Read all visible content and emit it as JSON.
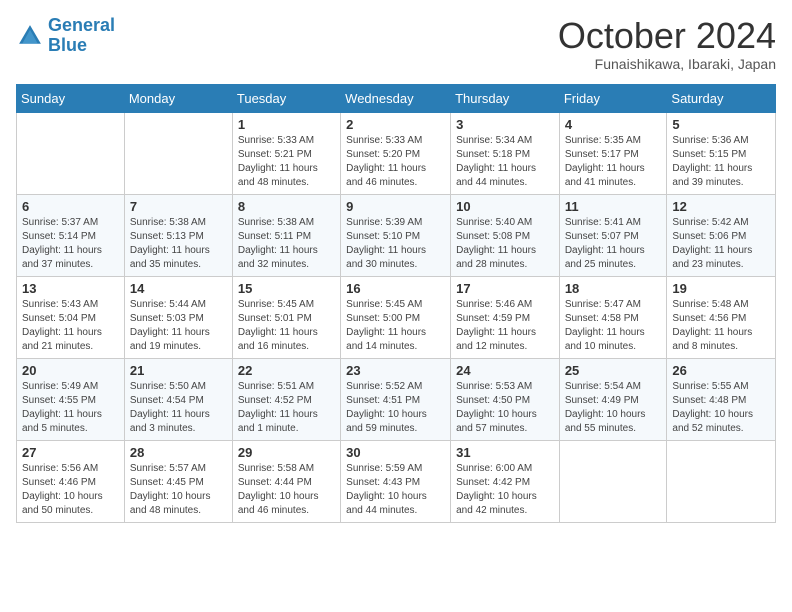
{
  "header": {
    "logo_line1": "General",
    "logo_line2": "Blue",
    "month": "October 2024",
    "location": "Funaishikawa, Ibaraki, Japan"
  },
  "weekdays": [
    "Sunday",
    "Monday",
    "Tuesday",
    "Wednesday",
    "Thursday",
    "Friday",
    "Saturday"
  ],
  "weeks": [
    [
      {
        "day": "",
        "detail": ""
      },
      {
        "day": "",
        "detail": ""
      },
      {
        "day": "1",
        "detail": "Sunrise: 5:33 AM\nSunset: 5:21 PM\nDaylight: 11 hours and 48 minutes."
      },
      {
        "day": "2",
        "detail": "Sunrise: 5:33 AM\nSunset: 5:20 PM\nDaylight: 11 hours and 46 minutes."
      },
      {
        "day": "3",
        "detail": "Sunrise: 5:34 AM\nSunset: 5:18 PM\nDaylight: 11 hours and 44 minutes."
      },
      {
        "day": "4",
        "detail": "Sunrise: 5:35 AM\nSunset: 5:17 PM\nDaylight: 11 hours and 41 minutes."
      },
      {
        "day": "5",
        "detail": "Sunrise: 5:36 AM\nSunset: 5:15 PM\nDaylight: 11 hours and 39 minutes."
      }
    ],
    [
      {
        "day": "6",
        "detail": "Sunrise: 5:37 AM\nSunset: 5:14 PM\nDaylight: 11 hours and 37 minutes."
      },
      {
        "day": "7",
        "detail": "Sunrise: 5:38 AM\nSunset: 5:13 PM\nDaylight: 11 hours and 35 minutes."
      },
      {
        "day": "8",
        "detail": "Sunrise: 5:38 AM\nSunset: 5:11 PM\nDaylight: 11 hours and 32 minutes."
      },
      {
        "day": "9",
        "detail": "Sunrise: 5:39 AM\nSunset: 5:10 PM\nDaylight: 11 hours and 30 minutes."
      },
      {
        "day": "10",
        "detail": "Sunrise: 5:40 AM\nSunset: 5:08 PM\nDaylight: 11 hours and 28 minutes."
      },
      {
        "day": "11",
        "detail": "Sunrise: 5:41 AM\nSunset: 5:07 PM\nDaylight: 11 hours and 25 minutes."
      },
      {
        "day": "12",
        "detail": "Sunrise: 5:42 AM\nSunset: 5:06 PM\nDaylight: 11 hours and 23 minutes."
      }
    ],
    [
      {
        "day": "13",
        "detail": "Sunrise: 5:43 AM\nSunset: 5:04 PM\nDaylight: 11 hours and 21 minutes."
      },
      {
        "day": "14",
        "detail": "Sunrise: 5:44 AM\nSunset: 5:03 PM\nDaylight: 11 hours and 19 minutes."
      },
      {
        "day": "15",
        "detail": "Sunrise: 5:45 AM\nSunset: 5:01 PM\nDaylight: 11 hours and 16 minutes."
      },
      {
        "day": "16",
        "detail": "Sunrise: 5:45 AM\nSunset: 5:00 PM\nDaylight: 11 hours and 14 minutes."
      },
      {
        "day": "17",
        "detail": "Sunrise: 5:46 AM\nSunset: 4:59 PM\nDaylight: 11 hours and 12 minutes."
      },
      {
        "day": "18",
        "detail": "Sunrise: 5:47 AM\nSunset: 4:58 PM\nDaylight: 11 hours and 10 minutes."
      },
      {
        "day": "19",
        "detail": "Sunrise: 5:48 AM\nSunset: 4:56 PM\nDaylight: 11 hours and 8 minutes."
      }
    ],
    [
      {
        "day": "20",
        "detail": "Sunrise: 5:49 AM\nSunset: 4:55 PM\nDaylight: 11 hours and 5 minutes."
      },
      {
        "day": "21",
        "detail": "Sunrise: 5:50 AM\nSunset: 4:54 PM\nDaylight: 11 hours and 3 minutes."
      },
      {
        "day": "22",
        "detail": "Sunrise: 5:51 AM\nSunset: 4:52 PM\nDaylight: 11 hours and 1 minute."
      },
      {
        "day": "23",
        "detail": "Sunrise: 5:52 AM\nSunset: 4:51 PM\nDaylight: 10 hours and 59 minutes."
      },
      {
        "day": "24",
        "detail": "Sunrise: 5:53 AM\nSunset: 4:50 PM\nDaylight: 10 hours and 57 minutes."
      },
      {
        "day": "25",
        "detail": "Sunrise: 5:54 AM\nSunset: 4:49 PM\nDaylight: 10 hours and 55 minutes."
      },
      {
        "day": "26",
        "detail": "Sunrise: 5:55 AM\nSunset: 4:48 PM\nDaylight: 10 hours and 52 minutes."
      }
    ],
    [
      {
        "day": "27",
        "detail": "Sunrise: 5:56 AM\nSunset: 4:46 PM\nDaylight: 10 hours and 50 minutes."
      },
      {
        "day": "28",
        "detail": "Sunrise: 5:57 AM\nSunset: 4:45 PM\nDaylight: 10 hours and 48 minutes."
      },
      {
        "day": "29",
        "detail": "Sunrise: 5:58 AM\nSunset: 4:44 PM\nDaylight: 10 hours and 46 minutes."
      },
      {
        "day": "30",
        "detail": "Sunrise: 5:59 AM\nSunset: 4:43 PM\nDaylight: 10 hours and 44 minutes."
      },
      {
        "day": "31",
        "detail": "Sunrise: 6:00 AM\nSunset: 4:42 PM\nDaylight: 10 hours and 42 minutes."
      },
      {
        "day": "",
        "detail": ""
      },
      {
        "day": "",
        "detail": ""
      }
    ]
  ]
}
